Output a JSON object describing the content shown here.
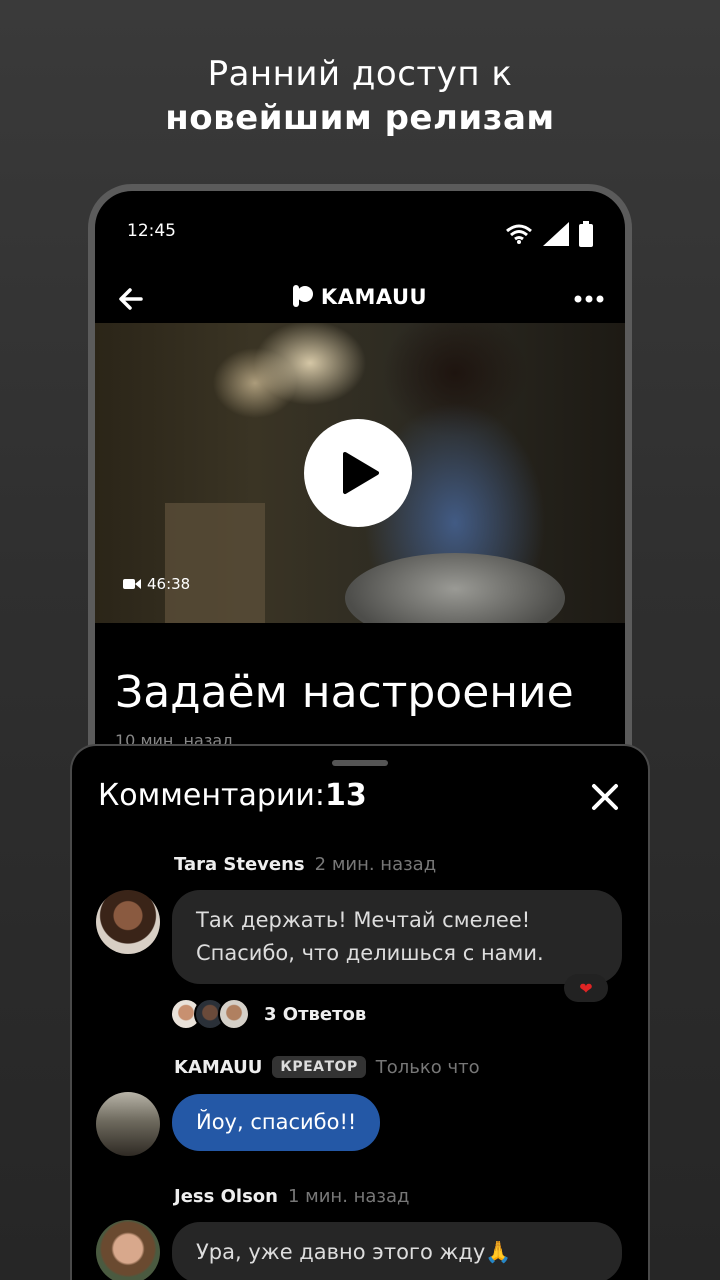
{
  "headline": {
    "line1": "Ранний доступ к",
    "line2": "новейшим релизам"
  },
  "status_bar": {
    "time": "12:45"
  },
  "app_bar": {
    "brand": "KAMAUU"
  },
  "video": {
    "duration": "46:38"
  },
  "post": {
    "title": "Задаём настроение",
    "time": "10 мин. назад"
  },
  "comments_sheet": {
    "title": "Комментарии:",
    "count": "13",
    "comments": [
      {
        "author": "Tara Stevens",
        "time": "2 мин. назад",
        "text_line1": "Так держать! Мечтай смелее!",
        "text_line2": "Спасибо, что делишься с нами.",
        "reaction": "❤",
        "replies_label": "3 Ответов"
      },
      {
        "author": "KAMAUU",
        "badge": "КРЕАТОР",
        "time": "Только что",
        "text": "Йоу, спасибо!!"
      },
      {
        "author": "Jess Olson",
        "time": "1 мин. назад",
        "text": "Ура, уже давно этого жду🙏"
      }
    ]
  },
  "colors": {
    "background": "#333333",
    "reply_bubble": "#2458a6",
    "comment_bubble": "#262626",
    "heart": "#e02424"
  }
}
